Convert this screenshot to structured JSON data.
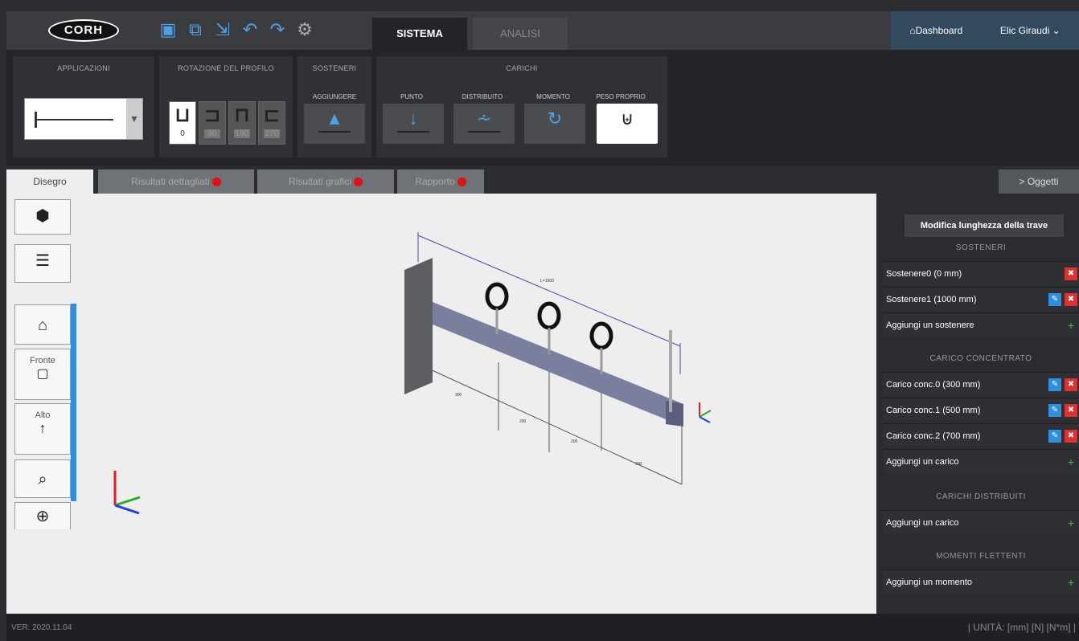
{
  "header": {
    "logo_text": "CORH",
    "tabs": [
      {
        "label": "SISTEMA"
      },
      {
        "label": "ANALISI"
      }
    ],
    "dashboard_label": "Dashboard",
    "user_label": "Elic Giraudi ⌄"
  },
  "ribbon": {
    "applicazioni_title": "APPLICAZIONI",
    "rotazione_title": "ROTAZIONE DEL PROFILO",
    "rotations": [
      "0",
      "90",
      "180",
      "270"
    ],
    "sosteneri_title": "SOSTENERI",
    "aggiungere_label": "AGGIUNGERE",
    "carichi_title": "CARICHI",
    "loads": [
      "PUNTO",
      "DISTRIBUITO",
      "MOMENTO",
      "PESO PROPRIO"
    ]
  },
  "subtabs": {
    "disegno": "Disegro",
    "risultati_dettagliati": "Risultati dettagliati",
    "risultati_grafici": "Risultati grafici",
    "rapporto": "Rapporto",
    "oggetti": "> Oggetti"
  },
  "left_tools": {
    "fronte_label": "Fronte",
    "alto_label": "Alto"
  },
  "drawing": {
    "dim_total": "L=1000",
    "dims": [
      "300",
      "200",
      "200",
      "300"
    ]
  },
  "panel": {
    "modify_button": "Modifica lunghezza della trave",
    "sosteneri_heading": "SOSTENERI",
    "sosteneri": [
      "Sostenere0 (0 mm)",
      "Sostenere1 (1000 mm)"
    ],
    "add_support": "Aggiungi un sostenere",
    "carico_heading": "CARICO CONCENTRATO",
    "carichi": [
      "Carico conc.0 (300 mm)",
      "Carico conc.1 (500 mm)",
      "Carico conc.2 (700 mm)"
    ],
    "add_load": "Aggiungi un carico",
    "distribuiti_heading": "CARICHI DISTRIBUITI",
    "add_distributed": "Aggiungi un carico",
    "momenti_heading": "MOMENTI FLETTENTI",
    "add_moment": "Aggiungi un momento"
  },
  "footer": {
    "version": "VER. 2020.11.04",
    "units": "| UNITÀ: [mm] [N] [N*m] |"
  }
}
